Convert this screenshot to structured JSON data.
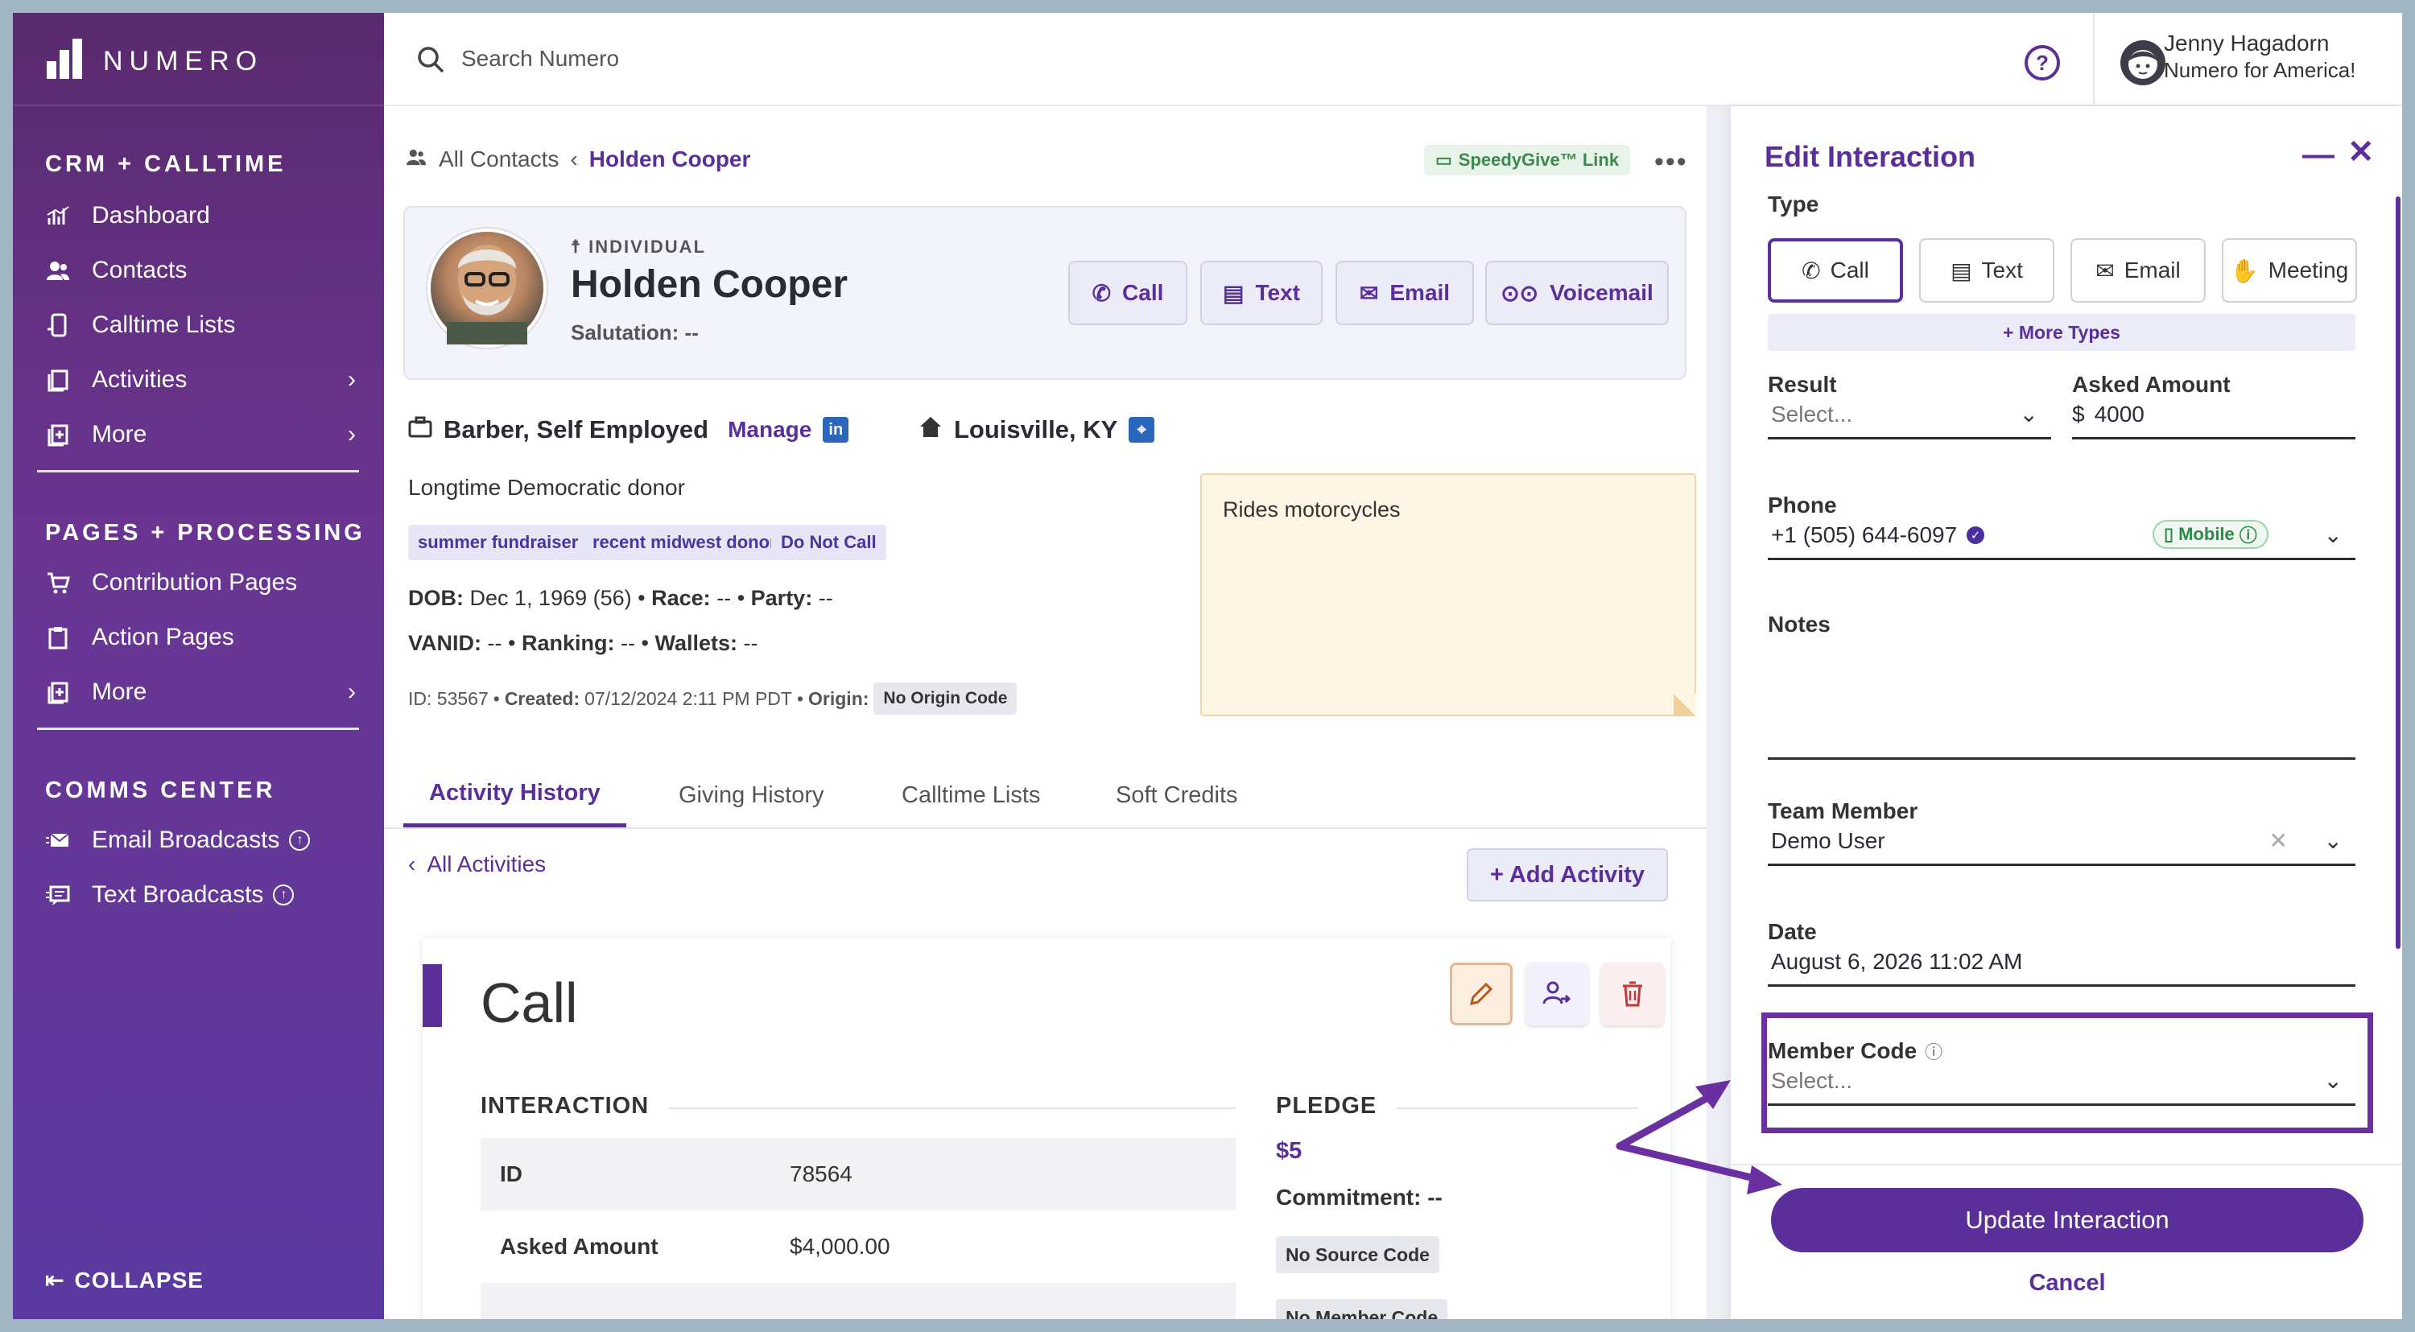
{
  "sidebar": {
    "brand": "NUMERO",
    "sections": [
      {
        "title": "CRM + CALLTIME"
      },
      {
        "title": "PAGES + PROCESSING"
      },
      {
        "title": "COMMS CENTER"
      }
    ],
    "items": [
      {
        "label": "Dashboard",
        "icon": "dashboard-icon"
      },
      {
        "label": "Contacts",
        "icon": "contacts-icon"
      },
      {
        "label": "Calltime Lists",
        "icon": "phone-list-icon"
      },
      {
        "label": "Activities",
        "icon": "activities-icon"
      },
      {
        "label": "More",
        "icon": "more-icon"
      },
      {
        "label": "Contribution Pages",
        "icon": "cart-icon"
      },
      {
        "label": "Action Pages",
        "icon": "clipboard-icon"
      },
      {
        "label": "More",
        "icon": "more-icon"
      },
      {
        "label": "Email Broadcasts",
        "icon": "email-broadcast-icon"
      },
      {
        "label": "Text Broadcasts",
        "icon": "text-broadcast-icon"
      }
    ],
    "collapse_label": "COLLAPSE"
  },
  "topbar": {
    "search_placeholder": "Search Numero",
    "user_name": "Jenny Hagadorn",
    "user_org": "Numero for America!"
  },
  "contact": {
    "breadcrumb_root": "All Contacts",
    "breadcrumb_current": "Holden Cooper",
    "speedygive": "SpeedyGive™ Link",
    "type": "INDIVIDUAL",
    "name": "Holden Cooper",
    "salutation": "Salutation: --",
    "actions": [
      "Call",
      "Text",
      "Email",
      "Voicemail"
    ],
    "occupation": "Barber, Self Employed",
    "manage": "Manage",
    "linkedin": "in",
    "location": "Louisville, KY",
    "description": "Longtime Democratic donor",
    "tags": [
      "summer fundraiser",
      "recent midwest donor",
      "Do Not Call"
    ],
    "dob_label": "DOB:",
    "dob": "Dec 1, 1969 (56)",
    "race_label": "Race:",
    "race": "--",
    "party_label": "Party:",
    "party": "--",
    "vanid_label": "VANID:",
    "vanid": "--",
    "ranking_label": "Ranking:",
    "ranking": "--",
    "wallets_label": "Wallets:",
    "wallets": "--",
    "id_text": "ID: 53567",
    "created_label": "Created:",
    "created": "07/12/2024 2:11 PM PDT",
    "origin_label": "Origin:",
    "origin_code": "No Origin Code",
    "note": "Rides motorcycles",
    "dot": "•"
  },
  "tabs": [
    "Activity History",
    "Giving History",
    "Calltime Lists",
    "Soft Credits"
  ],
  "activity": {
    "back_label": "All Activities",
    "add_label": "+ Add Activity",
    "title": "Call",
    "interaction_head": "INTERACTION",
    "pledge_head": "PLEDGE",
    "rows": [
      {
        "label": "ID",
        "value": "78564"
      },
      {
        "label": "Asked Amount",
        "value": "$4,000.00"
      }
    ],
    "pledge_amount": "$5",
    "commitment": "Commitment: --",
    "source_code": "No Source Code",
    "member_code": "No Member Code"
  },
  "drawer": {
    "title": "Edit Interaction",
    "type_label": "Type",
    "types": [
      "Call",
      "Text",
      "Email",
      "Meeting"
    ],
    "more_types": "+ More Types",
    "result_label": "Result",
    "result_placeholder": "Select...",
    "asked_label": "Asked Amount",
    "asked_currency": "$",
    "asked_value": "4000",
    "phone_label": "Phone",
    "phone_value": "+1 (505) 644-6097",
    "phone_type": "Mobile",
    "notes_label": "Notes",
    "team_label": "Team Member",
    "team_value": "Demo User",
    "date_label": "Date",
    "date_value": "August 6, 2026 11:02 AM",
    "member_code_label": "Member Code",
    "member_code_placeholder": "Select...",
    "update_label": "Update Interaction",
    "cancel_label": "Cancel"
  },
  "colors": {
    "accent": "#5b2f9a",
    "sidebar_top": "#5a2a6e",
    "sidebar_bottom": "#5a3aa0"
  }
}
